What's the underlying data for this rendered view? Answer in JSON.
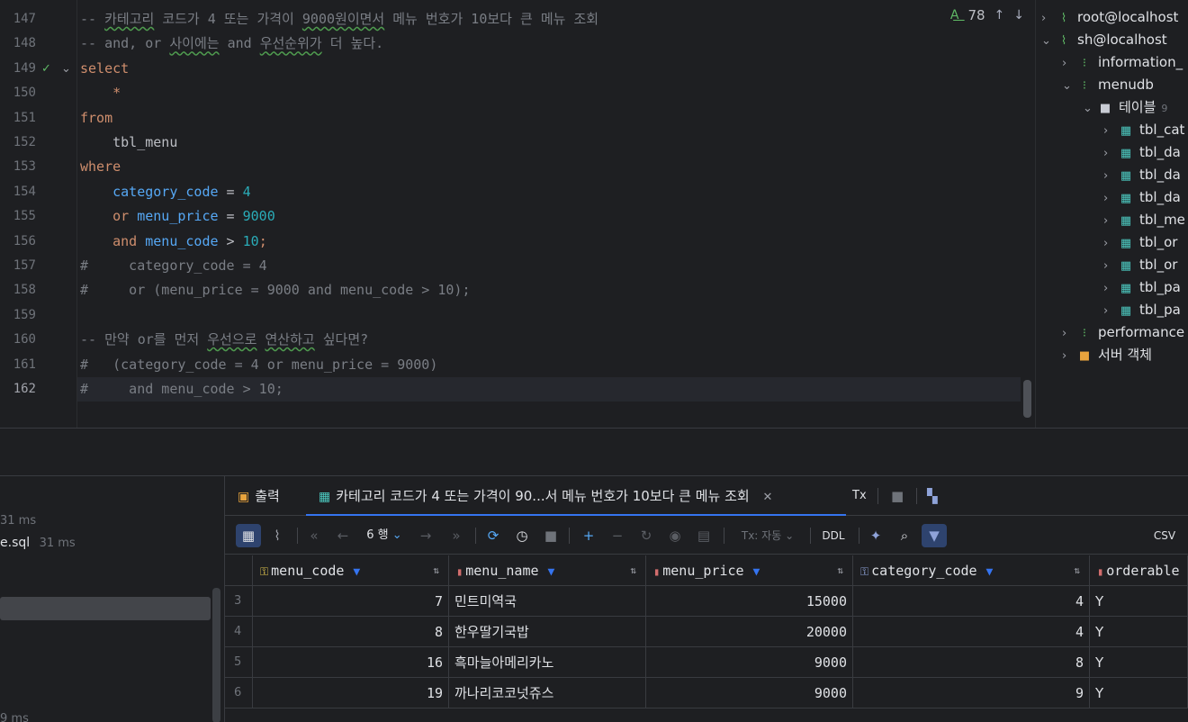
{
  "editor": {
    "lines": [
      {
        "no": "147",
        "segments": [
          {
            "t": "-- ",
            "c": "cmt"
          },
          {
            "t": "카테고리",
            "c": "cmt und"
          },
          {
            "t": " 코드가 4 또는 가격이 ",
            "c": "cmt"
          },
          {
            "t": "9000원이면서",
            "c": "cmt und"
          },
          {
            "t": " 메뉴 번호가 10보다 큰 메뉴 조회",
            "c": "cmt"
          }
        ]
      },
      {
        "no": "148",
        "segments": [
          {
            "t": "-- and, or ",
            "c": "cmt"
          },
          {
            "t": "사이에는",
            "c": "cmt und"
          },
          {
            "t": " and ",
            "c": "cmt"
          },
          {
            "t": "우선순위가",
            "c": "cmt und"
          },
          {
            "t": " 더 높다.",
            "c": "cmt"
          }
        ]
      },
      {
        "no": "149",
        "segments": [
          {
            "t": "select",
            "c": "kw"
          }
        ]
      },
      {
        "no": "150",
        "segments": [
          {
            "t": "    *",
            "c": "kw"
          }
        ]
      },
      {
        "no": "151",
        "segments": [
          {
            "t": "from",
            "c": "kw"
          }
        ]
      },
      {
        "no": "152",
        "segments": [
          {
            "t": "    tbl_menu",
            "c": "plain"
          }
        ]
      },
      {
        "no": "153",
        "segments": [
          {
            "t": "where",
            "c": "kw"
          }
        ]
      },
      {
        "no": "154",
        "segments": [
          {
            "t": "    category_code",
            "c": "id"
          },
          {
            "t": " = ",
            "c": "plain"
          },
          {
            "t": "4",
            "c": "num"
          }
        ]
      },
      {
        "no": "155",
        "segments": [
          {
            "t": "    or ",
            "c": "kw"
          },
          {
            "t": "menu_price",
            "c": "id"
          },
          {
            "t": " = ",
            "c": "plain"
          },
          {
            "t": "9000",
            "c": "num"
          }
        ]
      },
      {
        "no": "156",
        "segments": [
          {
            "t": "    and ",
            "c": "kw"
          },
          {
            "t": "menu_code",
            "c": "id"
          },
          {
            "t": " > ",
            "c": "plain"
          },
          {
            "t": "10",
            "c": "num"
          },
          {
            "t": ";",
            "c": "kw"
          }
        ]
      },
      {
        "no": "157",
        "segments": [
          {
            "t": "#     category_code = 4",
            "c": "cmt"
          }
        ]
      },
      {
        "no": "158",
        "segments": [
          {
            "t": "#     or (menu_price = 9000 and menu_code > 10);",
            "c": "cmt"
          }
        ]
      },
      {
        "no": "159",
        "segments": []
      },
      {
        "no": "160",
        "segments": [
          {
            "t": "-- 만약 or를 먼저 ",
            "c": "cmt"
          },
          {
            "t": "우선으로",
            "c": "cmt und"
          },
          {
            "t": " ",
            "c": "cmt"
          },
          {
            "t": "연산하고",
            "c": "cmt und"
          },
          {
            "t": " 싶다면?",
            "c": "cmt"
          }
        ]
      },
      {
        "no": "161",
        "segments": [
          {
            "t": "#   (category_code = 4 or menu_price = 9000)",
            "c": "cmt"
          }
        ]
      },
      {
        "no": "162",
        "segments": [
          {
            "t": "#     and menu_code > 10;",
            "c": "cmt"
          }
        ]
      }
    ],
    "inspection_count": "78"
  },
  "tree": [
    {
      "label": "root@localhost",
      "indent": 0,
      "chev": "›",
      "icon": "server-icon",
      "glyph": "⌇",
      "color": "#5fb865",
      "extra": ""
    },
    {
      "label": "sh@localhost",
      "indent": 0,
      "chev": "⌄",
      "icon": "server-icon",
      "glyph": "⌇",
      "color": "#5fb865",
      "extra": ""
    },
    {
      "label": "information_",
      "indent": 1,
      "chev": "›",
      "icon": "schema-icon",
      "glyph": "⁝",
      "color": "#5fb865",
      "extra": ""
    },
    {
      "label": "menudb",
      "indent": 1,
      "chev": "⌄",
      "icon": "schema-icon",
      "glyph": "⁝",
      "color": "#5fb865",
      "extra": ""
    },
    {
      "label": "테이블",
      "indent": 2,
      "chev": "⌄",
      "icon": "folder-icon",
      "glyph": "■",
      "color": "#c9ccd4",
      "extra": "9"
    },
    {
      "label": "tbl_cat",
      "indent": 3,
      "chev": "›",
      "icon": "table-icon",
      "glyph": "▦",
      "color": "#4cc9c0",
      "extra": ""
    },
    {
      "label": "tbl_da",
      "indent": 3,
      "chev": "›",
      "icon": "table-icon",
      "glyph": "▦",
      "color": "#4cc9c0",
      "extra": ""
    },
    {
      "label": "tbl_da",
      "indent": 3,
      "chev": "›",
      "icon": "table-icon",
      "glyph": "▦",
      "color": "#4cc9c0",
      "extra": ""
    },
    {
      "label": "tbl_da",
      "indent": 3,
      "chev": "›",
      "icon": "table-icon",
      "glyph": "▦",
      "color": "#4cc9c0",
      "extra": ""
    },
    {
      "label": "tbl_me",
      "indent": 3,
      "chev": "›",
      "icon": "table-icon",
      "glyph": "▦",
      "color": "#4cc9c0",
      "extra": ""
    },
    {
      "label": "tbl_or",
      "indent": 3,
      "chev": "›",
      "icon": "table-icon",
      "glyph": "▦",
      "color": "#4cc9c0",
      "extra": ""
    },
    {
      "label": "tbl_or",
      "indent": 3,
      "chev": "›",
      "icon": "table-icon",
      "glyph": "▦",
      "color": "#4cc9c0",
      "extra": ""
    },
    {
      "label": "tbl_pa",
      "indent": 3,
      "chev": "›",
      "icon": "table-icon",
      "glyph": "▦",
      "color": "#4cc9c0",
      "extra": ""
    },
    {
      "label": "tbl_pa",
      "indent": 3,
      "chev": "›",
      "icon": "table-icon",
      "glyph": "▦",
      "color": "#4cc9c0",
      "extra": ""
    },
    {
      "label": "performance",
      "indent": 1,
      "chev": "›",
      "icon": "schema-icon",
      "glyph": "⁝",
      "color": "#5fb865",
      "extra": ""
    },
    {
      "label": "서버 객체",
      "indent": 1,
      "chev": "›",
      "icon": "server-objects-icon",
      "glyph": "■",
      "color": "#e8a33d",
      "extra": ""
    }
  ],
  "services": {
    "items": [
      {
        "text": "",
        "time": "31 ms"
      },
      {
        "text": "e.sql",
        "time": "31 ms"
      },
      {
        "text": "",
        "time": "9 ms"
      }
    ]
  },
  "results": {
    "tabs": {
      "output": "출력",
      "query": "카테고리 코드가 4 또는 가격이 90...서 메뉴 번호가 10보다 큰 메뉴 조회",
      "tx": "Tx"
    },
    "toolbar": {
      "rows": "6 행",
      "tx_mode": "Tx: 자동",
      "ddl": "DDL",
      "export": "CSV"
    },
    "columns": [
      {
        "name": "menu_code",
        "icon": "primary-key-icon"
      },
      {
        "name": "menu_name",
        "icon": "column-icon"
      },
      {
        "name": "menu_price",
        "icon": "column-icon"
      },
      {
        "name": "category_code",
        "icon": "foreign-key-icon"
      },
      {
        "name": "orderable",
        "icon": "column-icon"
      }
    ],
    "rows": [
      {
        "rn": "3",
        "menu_code": "7",
        "menu_name": "민트미역국",
        "menu_price": "15000",
        "category_code": "4",
        "orderable": "Y"
      },
      {
        "rn": "4",
        "menu_code": "8",
        "menu_name": "한우딸기국밥",
        "menu_price": "20000",
        "category_code": "4",
        "orderable": "Y"
      },
      {
        "rn": "5",
        "menu_code": "16",
        "menu_name": "흑마늘아메리카노",
        "menu_price": "9000",
        "category_code": "8",
        "orderable": "Y"
      },
      {
        "rn": "6",
        "menu_code": "19",
        "menu_name": "까나리코코넛쥬스",
        "menu_price": "9000",
        "category_code": "9",
        "orderable": "Y"
      }
    ]
  },
  "colors": {
    "accent": "#3574f0",
    "keyword": "#cf8e6d",
    "identifier": "#56a8f5",
    "number": "#2aacb8",
    "comment": "#7a7e85"
  }
}
